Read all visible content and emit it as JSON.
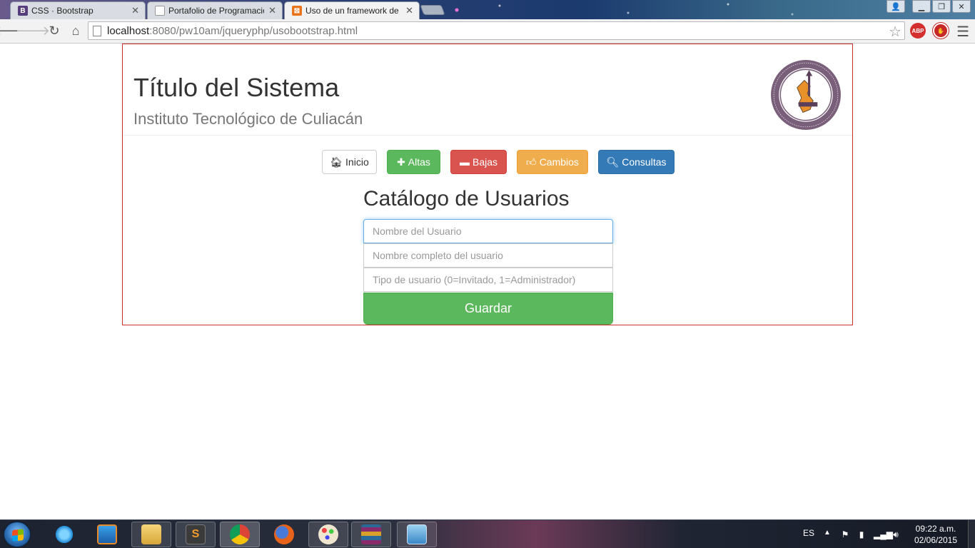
{
  "browser": {
    "tabs": [
      {
        "title": "CSS · Bootstrap",
        "favicon": "B",
        "favicon_color": "#563d7c",
        "active": false
      },
      {
        "title": "Portafolio de Programacio",
        "favicon": "",
        "favicon_color": "#ffffff",
        "active": false
      },
      {
        "title": "Uso de un framework de C",
        "favicon": "",
        "favicon_color": "#e8741c",
        "active": true
      }
    ],
    "url_host": "localhost",
    "url_rest": ":8080/pw10am/jqueryphp/usobootstrap.html",
    "extensions": [
      {
        "label": "ABP",
        "color": "#d32f2f"
      },
      {
        "label": "",
        "color": "#c62828"
      }
    ]
  },
  "page": {
    "title": "Título del Sistema",
    "subtitle": "Instituto Tecnológico de Culiacán",
    "logo_icon": "itc-seal-logo",
    "nav": {
      "inicio": "Inicio",
      "altas": "Altas",
      "bajas": "Bajas",
      "cambios": "Cambios",
      "consultas": "Consultas"
    },
    "form": {
      "heading": "Catálogo de Usuarios",
      "username_placeholder": "Nombre del Usuario",
      "fullname_placeholder": "Nombre completo del usuario",
      "usertype_placeholder": "Tipo de usuario (0=Invitado, 1=Administrador)",
      "save_label": "Guardar"
    },
    "colors": {
      "success": "#5cb85c",
      "danger": "#d9534f",
      "warning": "#f0ad4e",
      "primary": "#337ab7",
      "frame_border": "#c9302c"
    }
  },
  "taskbar": {
    "language": "ES",
    "time": "09:22 a.m.",
    "date": "02/06/2015"
  }
}
